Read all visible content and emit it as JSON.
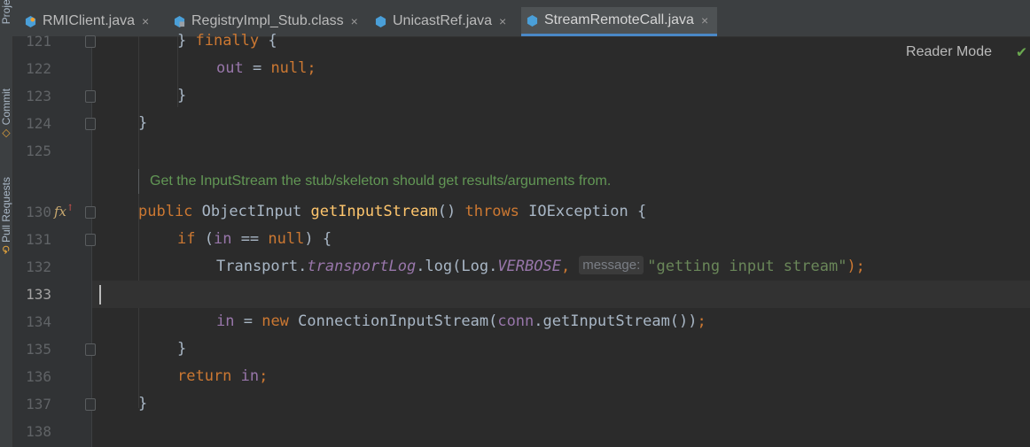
{
  "tool_window_strip": {
    "project_label": "Project",
    "commit_label": "Commit",
    "pull_requests_label": "Pull Requests"
  },
  "tabs": [
    {
      "label": "RMIClient.java",
      "icon": "java-class-icon",
      "active": false
    },
    {
      "label": "RegistryImpl_Stub.class",
      "icon": "class-file-icon",
      "active": false
    },
    {
      "label": "UnicastRef.java",
      "icon": "java-class-icon",
      "active": false
    },
    {
      "label": "StreamRemoteCall.java",
      "icon": "java-class-icon",
      "active": true
    }
  ],
  "tab_close_glyph": "×",
  "editor": {
    "reader_mode_label": "Reader Mode",
    "inspection_icon": "checkmark-icon",
    "doc_comment": "Get the InputStream the stub/skeleton should get results/arguments from.",
    "param_hint": "message:",
    "lines": {
      "l121": {
        "num": "121",
        "t0": "} ",
        "t1": "finally",
        "t2": " {"
      },
      "l122": {
        "num": "122",
        "t0": "out",
        "t1": " = ",
        "t2": "null",
        "t3": ";"
      },
      "l123": {
        "num": "123",
        "t0": "}"
      },
      "l124": {
        "num": "124",
        "t0": "}"
      },
      "l125": {
        "num": "125"
      },
      "l130": {
        "num": "130",
        "t0": "public",
        "t1": " ObjectInput ",
        "t2": "getInputStream",
        "t3": "() ",
        "t4": "throws",
        "t5": " IOException {"
      },
      "l131": {
        "num": "131",
        "t0": "if",
        "t1": " (",
        "t2": "in",
        "t3": " == ",
        "t4": "null",
        "t5": ") {"
      },
      "l132": {
        "num": "132",
        "t0": "Transport.",
        "t1": "transportLog",
        "t2": ".log(Log.",
        "t3": "VERBOSE",
        "t4": ",",
        "t5": "\"getting input stream\"",
        "t6": ");"
      },
      "l133": {
        "num": "133"
      },
      "l134": {
        "num": "134",
        "t0": "in",
        "t1": " = ",
        "t2": "new",
        "t3": " ConnectionInputStream(",
        "t4": "conn",
        "t5": ".getInputStream())",
        "t6": ";"
      },
      "l135": {
        "num": "135",
        "t0": "}"
      },
      "l136": {
        "num": "136",
        "t0": "return",
        "t1": " ",
        "t2": "in",
        "t3": ";"
      },
      "l137": {
        "num": "137",
        "t0": "}"
      },
      "l138": {
        "num": "138"
      }
    },
    "gutter_icon": "fx-function-icon",
    "gutter_fx": "fx",
    "gutter_arrow": "↑"
  },
  "colors": {
    "keyword": "#cc7832",
    "field": "#9876aa",
    "method": "#ffc66d",
    "string": "#6a8759",
    "doc": "#629755",
    "active_tab_underline": "#4a88c7"
  }
}
